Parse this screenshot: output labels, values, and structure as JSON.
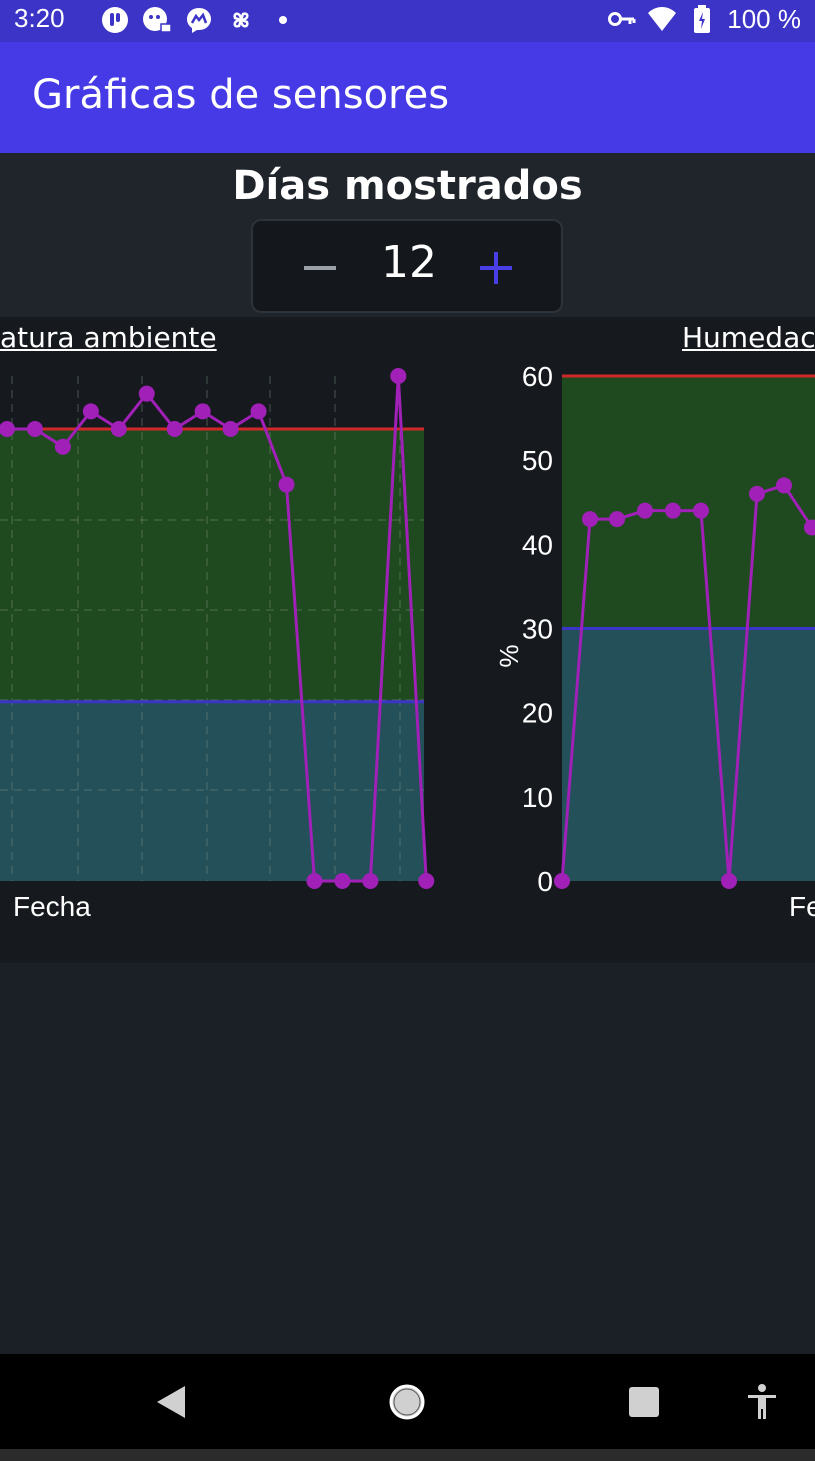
{
  "status_bar": {
    "time": "3:20",
    "battery": "100 %",
    "left_icons": [
      "app-notification-icon",
      "chat-notification-icon",
      "messenger-icon",
      "pinwheel-icon",
      "more-dot-icon"
    ],
    "right_icons": [
      "vpn-key-icon",
      "wifi-icon",
      "battery-icon"
    ]
  },
  "app_bar": {
    "title": "Gráficas de sensores"
  },
  "days": {
    "title": "Días mostrados",
    "value": "12"
  },
  "charts": {
    "left_title": "atura ambiente",
    "left_xlabel": "Fecha",
    "right_title": "Humedac",
    "right_xlabel": "Fe",
    "right_ylabel": "%"
  },
  "chart_data": [
    {
      "type": "line",
      "title": "atura ambiente",
      "xlabel": "Fecha",
      "ylabel": "",
      "grid": true,
      "band_colors": {
        "high": "#1f4a1f",
        "low": "#245059",
        "upper_line": "#d02828",
        "lower_line": "#3a34c8",
        "series": "#a020b8"
      },
      "y_points_rel": [
        0.895,
        0.895,
        0.86,
        0.93,
        0.895,
        0.965,
        0.895,
        0.93,
        0.895,
        0.93,
        0.785,
        0.0,
        0.0,
        0.0,
        1.0,
        0.0
      ],
      "thresholds_rel": {
        "upper": 0.895,
        "lower": 0.355
      }
    },
    {
      "type": "line",
      "title": "Humedac",
      "xlabel": "Fe",
      "ylabel": "%",
      "ylim": [
        0,
        60
      ],
      "y_ticks": [
        "0",
        "10",
        "20",
        "30",
        "40",
        "50",
        "60"
      ],
      "thresholds": {
        "upper": 60,
        "lower": 30
      },
      "band_colors": {
        "high": "#1f4a1f",
        "low": "#245059",
        "upper_line": "#d02828",
        "lower_line": "#3a34c8",
        "series": "#a020b8"
      },
      "values": [
        0,
        43,
        43,
        44,
        44,
        44,
        0,
        46,
        47,
        42
      ]
    }
  ],
  "navbar": {
    "icons": [
      "back-icon",
      "home-icon",
      "recents-icon",
      "accessibility-icon"
    ]
  }
}
